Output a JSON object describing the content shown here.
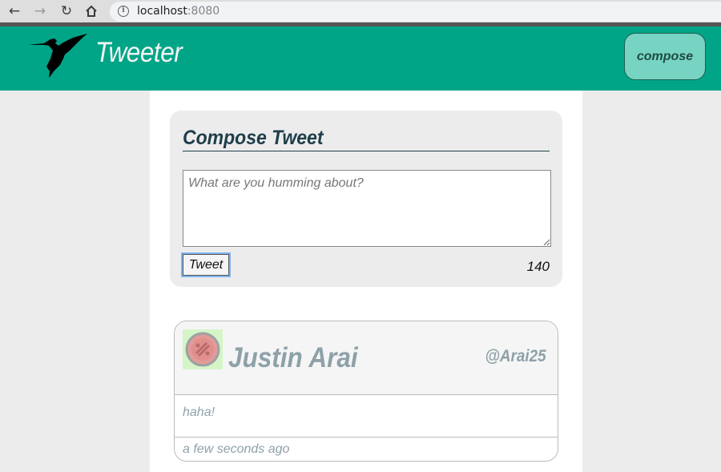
{
  "browser": {
    "url_host": "localhost",
    "url_port": ":8080"
  },
  "header": {
    "title": "Tweeter",
    "compose_label": "compose"
  },
  "compose": {
    "heading": "Compose Tweet",
    "placeholder": "What are you humming about?",
    "value": "",
    "submit_label": "Tweet",
    "counter": "140"
  },
  "tweets": [
    {
      "name": "Justin Arai",
      "handle": "@Arai25",
      "content": "haha!",
      "time": "a few seconds ago"
    }
  ],
  "colors": {
    "brand": "#00a587",
    "compose_button": "#77d4c2",
    "heading_text": "#1f3e4a",
    "muted_text": "#8da1a8"
  }
}
